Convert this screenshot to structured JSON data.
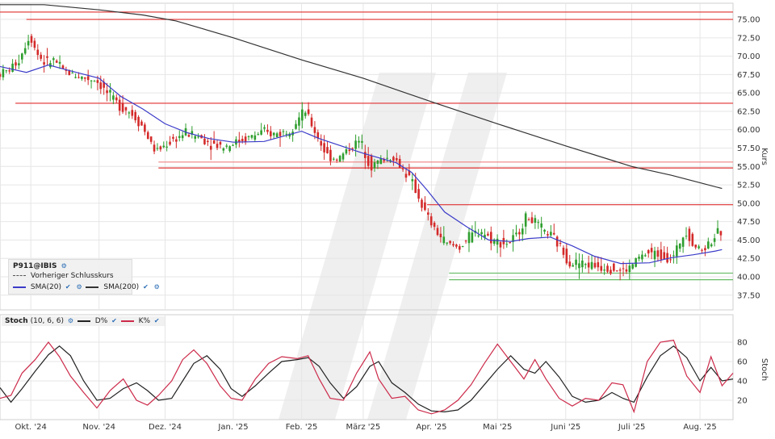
{
  "chart_data": [
    {
      "type": "candlestick",
      "ylabel": "Kurs",
      "ylim": [
        35.5,
        77.2
      ],
      "yticks": [
        37.5,
        40.0,
        42.5,
        45.0,
        47.5,
        50.0,
        52.5,
        55.0,
        57.5,
        60.0,
        62.5,
        65.0,
        67.5,
        70.0,
        72.5,
        75.0
      ],
      "x_labels": [
        {
          "label": "Okt. '24",
          "day": 14
        },
        {
          "label": "Nov. '24",
          "day": 45
        },
        {
          "label": "Dez. '24",
          "day": 75
        },
        {
          "label": "Jan. '25",
          "day": 106
        },
        {
          "label": "Feb. '25",
          "day": 137
        },
        {
          "label": "März '25",
          "day": 165
        },
        {
          "label": "Apr. '25",
          "day": 196
        },
        {
          "label": "Mai '25",
          "day": 226
        },
        {
          "label": "Juni '25",
          "day": 257
        },
        {
          "label": "Juli '25",
          "day": 287
        },
        {
          "label": "Aug. '25",
          "day": 318
        }
      ],
      "x_range_days": [
        0,
        333
      ],
      "sma20_anchors": [
        [
          0,
          68.6
        ],
        [
          12,
          67.8
        ],
        [
          22,
          68.8
        ],
        [
          32,
          68.0
        ],
        [
          45,
          67.0
        ],
        [
          55,
          64.5
        ],
        [
          65,
          62.8
        ],
        [
          75,
          60.8
        ],
        [
          85,
          59.6
        ],
        [
          95,
          58.8
        ],
        [
          106,
          58.3
        ],
        [
          120,
          58.4
        ],
        [
          137,
          59.8
        ],
        [
          145,
          58.8
        ],
        [
          155,
          57.8
        ],
        [
          165,
          56.8
        ],
        [
          172,
          56.2
        ],
        [
          180,
          55.5
        ],
        [
          187,
          54.2
        ],
        [
          194,
          51.8
        ],
        [
          202,
          48.8
        ],
        [
          212,
          46.8
        ],
        [
          222,
          45.0
        ],
        [
          232,
          44.8
        ],
        [
          240,
          45.2
        ],
        [
          250,
          45.4
        ],
        [
          260,
          44.2
        ],
        [
          270,
          42.8
        ],
        [
          282,
          41.8
        ],
        [
          295,
          41.9
        ],
        [
          305,
          42.6
        ],
        [
          315,
          43.0
        ],
        [
          325,
          43.5
        ],
        [
          328,
          43.7
        ]
      ],
      "sma200_anchors": [
        [
          0,
          77.0
        ],
        [
          20,
          77.0
        ],
        [
          45,
          76.3
        ],
        [
          65,
          75.6
        ],
        [
          80,
          74.8
        ],
        [
          106,
          72.5
        ],
        [
          137,
          69.5
        ],
        [
          165,
          67.0
        ],
        [
          196,
          63.8
        ],
        [
          226,
          60.8
        ],
        [
          257,
          57.8
        ],
        [
          287,
          55.0
        ],
        [
          305,
          53.8
        ],
        [
          318,
          52.8
        ],
        [
          328,
          52.0
        ]
      ],
      "price_anchors": [
        [
          0,
          67.5
        ],
        [
          5,
          68.0
        ],
        [
          10,
          69.5
        ],
        [
          15,
          73.0
        ],
        [
          18,
          70.5
        ],
        [
          22,
          69.0
        ],
        [
          26,
          69.5
        ],
        [
          30,
          68.0
        ],
        [
          35,
          67.5
        ],
        [
          40,
          67.0
        ],
        [
          45,
          66.8
        ],
        [
          50,
          65.0
        ],
        [
          55,
          63.5
        ],
        [
          60,
          62.5
        ],
        [
          65,
          61.0
        ],
        [
          72,
          57.0
        ],
        [
          76,
          57.8
        ],
        [
          80,
          58.6
        ],
        [
          86,
          59.6
        ],
        [
          92,
          59.0
        ],
        [
          98,
          58.0
        ],
        [
          104,
          57.8
        ],
        [
          110,
          58.5
        ],
        [
          115,
          59.0
        ],
        [
          120,
          59.6
        ],
        [
          126,
          59.4
        ],
        [
          132,
          59.8
        ],
        [
          137,
          61.5
        ],
        [
          140,
          62.5
        ],
        [
          144,
          60.0
        ],
        [
          150,
          56.5
        ],
        [
          155,
          56.0
        ],
        [
          160,
          57.5
        ],
        [
          165,
          58.5
        ],
        [
          170,
          55.0
        ],
        [
          175,
          56.0
        ],
        [
          180,
          56.3
        ],
        [
          186,
          54.0
        ],
        [
          190,
          52.0
        ],
        [
          194,
          49.0
        ],
        [
          198,
          46.8
        ],
        [
          204,
          44.5
        ],
        [
          210,
          44.0
        ],
        [
          215,
          45.5
        ],
        [
          220,
          46.3
        ],
        [
          225,
          45.0
        ],
        [
          232,
          44.5
        ],
        [
          236,
          45.5
        ],
        [
          240,
          48.0
        ],
        [
          243,
          47.8
        ],
        [
          247,
          46.5
        ],
        [
          252,
          45.5
        ],
        [
          256,
          44.0
        ],
        [
          260,
          42.0
        ],
        [
          266,
          41.8
        ],
        [
          272,
          41.5
        ],
        [
          278,
          41.3
        ],
        [
          283,
          40.8
        ],
        [
          287,
          41.0
        ],
        [
          291,
          42.5
        ],
        [
          296,
          43.2
        ],
        [
          302,
          43.0
        ],
        [
          307,
          42.4
        ],
        [
          310,
          44.5
        ],
        [
          313,
          46.5
        ],
        [
          316,
          44.5
        ],
        [
          320,
          43.6
        ],
        [
          324,
          44.8
        ],
        [
          328,
          46.0
        ]
      ],
      "horizontal_lines": [
        {
          "y": 76.0,
          "color": "#e03030",
          "from_day": 0
        },
        {
          "y": 75.0,
          "color": "#e03030",
          "from_day": 12
        },
        {
          "y": 63.6,
          "color": "#e03030",
          "from_day": 7
        },
        {
          "y": 55.6,
          "color": "#f08080",
          "from_day": 72
        },
        {
          "y": 54.8,
          "color": "#e03030",
          "from_day": 72
        },
        {
          "y": 49.8,
          "color": "#e03030",
          "from_day": 194
        },
        {
          "y": 40.5,
          "color": "#66bb66",
          "from_day": 204
        },
        {
          "y": 39.6,
          "color": "#66bb66",
          "from_day": 204
        }
      ],
      "colors": {
        "up": "#2e9e2e",
        "down": "#d42a2a",
        "sma20": "#3b3bc9",
        "sma200": "#333333",
        "grid": "#e6e6e6"
      }
    },
    {
      "type": "line",
      "ylabel": "Stoch",
      "ylim": [
        0,
        95
      ],
      "yticks": [
        20,
        40,
        60,
        80
      ],
      "series": [
        {
          "name": "D%",
          "color": "#222222",
          "anchors": [
            [
              0,
              33
            ],
            [
              5,
              18
            ],
            [
              10,
              32
            ],
            [
              16,
              50
            ],
            [
              22,
              67
            ],
            [
              27,
              76
            ],
            [
              32,
              66
            ],
            [
              38,
              40
            ],
            [
              44,
              20
            ],
            [
              50,
              22
            ],
            [
              56,
              32
            ],
            [
              62,
              38
            ],
            [
              67,
              30
            ],
            [
              72,
              20
            ],
            [
              78,
              22
            ],
            [
              83,
              40
            ],
            [
              88,
              58
            ],
            [
              94,
              66
            ],
            [
              100,
              52
            ],
            [
              105,
              32
            ],
            [
              110,
              24
            ],
            [
              116,
              35
            ],
            [
              122,
              48
            ],
            [
              128,
              60
            ],
            [
              135,
              62
            ],
            [
              140,
              64
            ],
            [
              145,
              55
            ],
            [
              150,
              38
            ],
            [
              156,
              22
            ],
            [
              162,
              34
            ],
            [
              168,
              55
            ],
            [
              172,
              60
            ],
            [
              178,
              38
            ],
            [
              184,
              28
            ],
            [
              190,
              16
            ],
            [
              196,
              9
            ],
            [
              202,
              8
            ],
            [
              208,
              10
            ],
            [
              214,
              20
            ],
            [
              220,
              36
            ],
            [
              226,
              52
            ],
            [
              232,
              66
            ],
            [
              238,
              52
            ],
            [
              243,
              48
            ],
            [
              248,
              60
            ],
            [
              254,
              44
            ],
            [
              260,
              24
            ],
            [
              266,
              18
            ],
            [
              272,
              20
            ],
            [
              278,
              28
            ],
            [
              283,
              22
            ],
            [
              288,
              18
            ],
            [
              294,
              44
            ],
            [
              300,
              66
            ],
            [
              306,
              76
            ],
            [
              312,
              64
            ],
            [
              318,
              40
            ],
            [
              323,
              54
            ],
            [
              328,
              40
            ],
            [
              333,
              42
            ]
          ]
        },
        {
          "name": "K%",
          "color": "#cc2a4a",
          "anchors": [
            [
              0,
              22
            ],
            [
              5,
              25
            ],
            [
              10,
              48
            ],
            [
              16,
              62
            ],
            [
              22,
              80
            ],
            [
              27,
              65
            ],
            [
              32,
              45
            ],
            [
              38,
              28
            ],
            [
              44,
              12
            ],
            [
              50,
              30
            ],
            [
              56,
              42
            ],
            [
              62,
              20
            ],
            [
              67,
              15
            ],
            [
              72,
              25
            ],
            [
              78,
              40
            ],
            [
              83,
              62
            ],
            [
              88,
              72
            ],
            [
              94,
              58
            ],
            [
              100,
              35
            ],
            [
              105,
              22
            ],
            [
              110,
              20
            ],
            [
              116,
              42
            ],
            [
              122,
              58
            ],
            [
              128,
              65
            ],
            [
              135,
              63
            ],
            [
              140,
              66
            ],
            [
              145,
              42
            ],
            [
              150,
              22
            ],
            [
              156,
              20
            ],
            [
              162,
              48
            ],
            [
              168,
              70
            ],
            [
              172,
              42
            ],
            [
              178,
              22
            ],
            [
              184,
              24
            ],
            [
              190,
              10
            ],
            [
              196,
              6
            ],
            [
              202,
              10
            ],
            [
              208,
              20
            ],
            [
              214,
              36
            ],
            [
              220,
              58
            ],
            [
              226,
              78
            ],
            [
              232,
              60
            ],
            [
              238,
              42
            ],
            [
              243,
              62
            ],
            [
              248,
              42
            ],
            [
              254,
              22
            ],
            [
              260,
              14
            ],
            [
              266,
              22
            ],
            [
              272,
              20
            ],
            [
              278,
              38
            ],
            [
              283,
              36
            ],
            [
              288,
              8
            ],
            [
              294,
              60
            ],
            [
              300,
              80
            ],
            [
              306,
              82
            ],
            [
              312,
              45
            ],
            [
              318,
              28
            ],
            [
              323,
              65
            ],
            [
              328,
              35
            ],
            [
              333,
              48
            ]
          ]
        }
      ]
    }
  ],
  "legend": {
    "symbol": "P911@IBIS",
    "prev_close": "Vorheriger Schlusskurs",
    "sma20": "SMA(20)",
    "sma200": "SMA(200)"
  },
  "stoch_legend": {
    "name": "Stoch",
    "params": "(10, 6, 6)",
    "d": "D%",
    "k": "K%"
  }
}
